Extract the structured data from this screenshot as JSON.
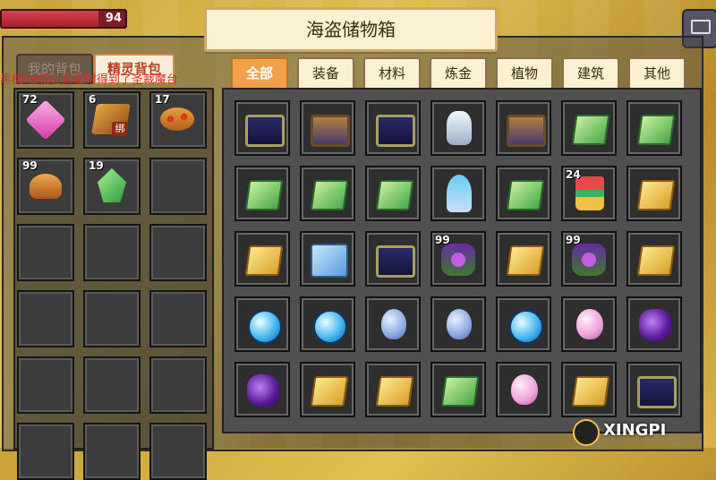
{
  "hud": {
    "hp_value": "94"
  },
  "title": "海盗储物箱",
  "left_tabs": [
    {
      "label": "我的背包",
      "active": false
    },
    {
      "label": "精灵背包",
      "active": true
    }
  ],
  "notice": "黑桃Ⅰ被箱在折福时得到了圣裁魔台",
  "backpack_slots": [
    {
      "icon": "gem-icon",
      "count": "72"
    },
    {
      "icon": "wood-icon",
      "count": "6",
      "bound": "绑"
    },
    {
      "icon": "pizza-icon",
      "count": "17"
    },
    {
      "icon": "bread-icon",
      "count": "99"
    },
    {
      "icon": "crystal-icon",
      "count": "19"
    },
    {
      "icon": "",
      "count": ""
    },
    {
      "icon": "",
      "count": ""
    },
    {
      "icon": "",
      "count": ""
    },
    {
      "icon": "",
      "count": ""
    },
    {
      "icon": "",
      "count": ""
    },
    {
      "icon": "",
      "count": ""
    },
    {
      "icon": "",
      "count": ""
    },
    {
      "icon": "",
      "count": ""
    },
    {
      "icon": "",
      "count": ""
    },
    {
      "icon": "",
      "count": ""
    },
    {
      "icon": "",
      "count": ""
    },
    {
      "icon": "",
      "count": ""
    },
    {
      "icon": "",
      "count": ""
    }
  ],
  "category_tabs": [
    {
      "label": "全部",
      "active": true
    },
    {
      "label": "装备",
      "active": false
    },
    {
      "label": "材料",
      "active": false
    },
    {
      "label": "炼金",
      "active": false
    },
    {
      "label": "植物",
      "active": false
    },
    {
      "label": "建筑",
      "active": false
    },
    {
      "label": "其他",
      "active": false
    }
  ],
  "storage_slots": [
    {
      "icon": "chest-gold-icon",
      "count": ""
    },
    {
      "icon": "chest-bronze-icon",
      "count": ""
    },
    {
      "icon": "chest-gold-icon",
      "count": ""
    },
    {
      "icon": "statue-icon",
      "count": ""
    },
    {
      "icon": "chest-bronze-icon",
      "count": ""
    },
    {
      "icon": "green-scroll-icon",
      "count": ""
    },
    {
      "icon": "green-scroll-icon",
      "count": ""
    },
    {
      "icon": "green-scroll-icon",
      "count": ""
    },
    {
      "icon": "green-scroll-icon",
      "count": ""
    },
    {
      "icon": "green-scroll-icon",
      "count": ""
    },
    {
      "icon": "tower-icon",
      "count": ""
    },
    {
      "icon": "green-scroll-icon",
      "count": ""
    },
    {
      "icon": "cake-tower-icon",
      "count": "24"
    },
    {
      "icon": "yellow-scroll-icon",
      "count": ""
    },
    {
      "icon": "yellow-scroll-icon",
      "count": ""
    },
    {
      "icon": "winged-scroll-icon",
      "count": ""
    },
    {
      "icon": "chest-gold-icon",
      "count": ""
    },
    {
      "icon": "purple-flower-icon",
      "count": "99"
    },
    {
      "icon": "yellow-scroll-icon",
      "count": ""
    },
    {
      "icon": "purple-flower-icon",
      "count": "99"
    },
    {
      "icon": "yellow-scroll-icon",
      "count": ""
    },
    {
      "icon": "blue-orb-icon",
      "count": ""
    },
    {
      "icon": "blue-orb-icon",
      "count": ""
    },
    {
      "icon": "blue-egg-icon",
      "count": ""
    },
    {
      "icon": "blue-egg-icon",
      "count": ""
    },
    {
      "icon": "blue-orb-icon",
      "count": ""
    },
    {
      "icon": "pink-egg-icon",
      "count": ""
    },
    {
      "icon": "purple-stone-icon",
      "count": ""
    },
    {
      "icon": "purple-stone-icon",
      "count": ""
    },
    {
      "icon": "yellow-scroll-icon",
      "count": ""
    },
    {
      "icon": "yellow-scroll-icon",
      "count": ""
    },
    {
      "icon": "green-scroll-icon",
      "count": ""
    },
    {
      "icon": "pink-egg-icon",
      "count": ""
    },
    {
      "icon": "yellow-scroll-icon",
      "count": ""
    },
    {
      "icon": "chest-gold-icon",
      "count": ""
    }
  ],
  "watermark": "XINGPI"
}
